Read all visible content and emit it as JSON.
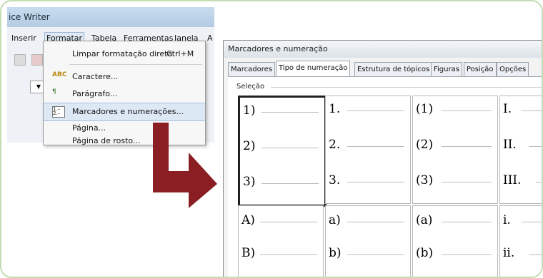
{
  "app_title": "ice Writer",
  "menu": {
    "items": [
      "Inserir",
      "Formatar",
      "Tabela",
      "Ferramentas",
      "Janela",
      "A"
    ]
  },
  "dropdown": {
    "items": [
      {
        "label": "Limpar formatação direta",
        "shortcut": "Ctrl+M",
        "icon": "clear-format-icon"
      },
      {
        "label": "Caractere...",
        "icon": "character-icon"
      },
      {
        "label": "Parágrafo...",
        "icon": "paragraph-icon"
      },
      {
        "label": "Marcadores e numerações...",
        "icon": "bullets-numbering-icon",
        "highlighted": true
      },
      {
        "label": "Página...",
        "icon": ""
      },
      {
        "label": "Página de rosto...",
        "icon": ""
      }
    ]
  },
  "arrow_color": "#8b1e22",
  "dialog": {
    "title": "Marcadores e numeração",
    "tabs": [
      "Marcadores",
      "Tipo de numeração",
      "Estrutura de tópicos",
      "Figuras",
      "Posição",
      "Opções"
    ],
    "selected_tab": "Tipo de numeração",
    "section_label": "Seleção",
    "grid": [
      [
        "1)",
        "2)",
        "3)"
      ],
      [
        "1.",
        "2.",
        "3."
      ],
      [
        "(1)",
        "(2)",
        "(3)"
      ],
      [
        "I.",
        "II.",
        "III."
      ],
      [
        "A)",
        "B)"
      ],
      [
        "a)",
        "b)"
      ],
      [
        "(a)",
        "(b)"
      ],
      [
        "i.",
        "ii."
      ]
    ]
  }
}
